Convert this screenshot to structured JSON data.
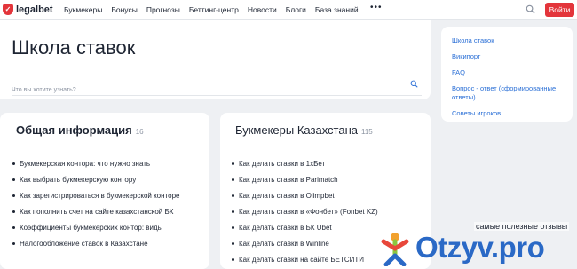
{
  "header": {
    "logo_text": "legalbet",
    "nav": [
      "Букмекеры",
      "Бонусы",
      "Прогнозы",
      "Беттинг-центр",
      "Новости",
      "Блоги",
      "База знаний"
    ],
    "more": "•••",
    "login": "Войти",
    "accent": "#e3353b"
  },
  "hero": {
    "title": "Школа ставок",
    "search_placeholder": "Что вы хотите узнать?"
  },
  "sidebar": {
    "links": [
      "Школа ставок",
      "Википорт",
      "FAQ",
      "Вопрос - ответ (сформированные ответы)",
      "Советы игроков"
    ]
  },
  "sections": [
    {
      "title": "Общая информация",
      "count": "16",
      "items": [
        "Букмекерская контора: что нужно знать",
        "Как выбрать букмекерскую контору",
        "Как зарегистрироваться в букмекерской конторе",
        "Как пополнить счет на сайте казахстанской БК",
        "Коэффициенты букмекерских контор: виды",
        "Налогообложение ставок в Казахстане"
      ]
    },
    {
      "title": "Букмекеры Казахстана",
      "count": "115",
      "items": [
        "Как делать ставки в 1хБет",
        "Как делать ставки в Parimatch",
        "Как делать ставки в Olimpbet",
        "Как делать ставки в «Фонбет» (Fonbet KZ)",
        "Как делать ставки в БК Ubet",
        "Как делать ставки в Winline",
        "Как делать ставки на сайте БЕТСИТИ"
      ]
    }
  ],
  "watermark": {
    "caption": "самые полезные отзывы",
    "brand": "Otzyv.pro",
    "brand_color": "#2a69c6"
  }
}
